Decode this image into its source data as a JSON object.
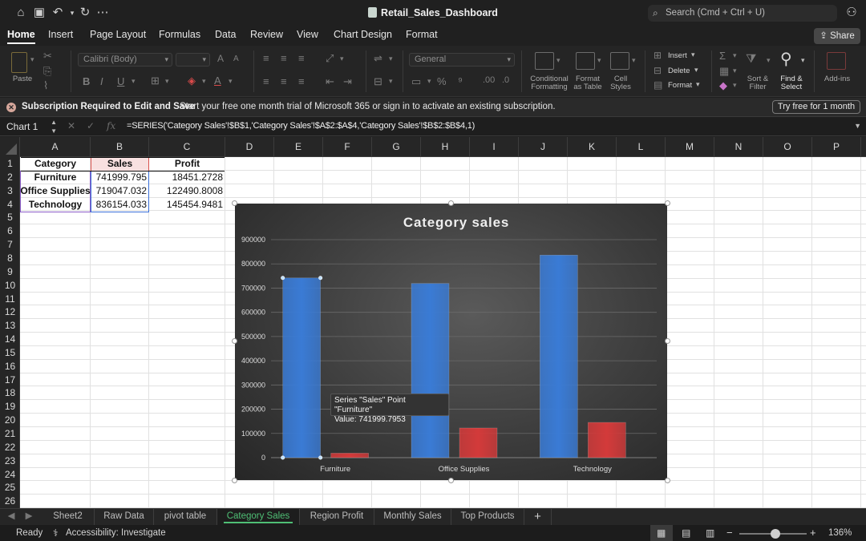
{
  "titlebar": {
    "doc_title": "Retail_Sales_Dashboard",
    "search_placeholder": "Search (Cmd + Ctrl + U)"
  },
  "ribbon_tabs": [
    "Home",
    "Insert",
    "Page Layout",
    "Formulas",
    "Data",
    "Review",
    "View",
    "Chart Design",
    "Format"
  ],
  "share_label": "Share",
  "ribbon": {
    "paste": "Paste",
    "font_name": "Calibri (Body)",
    "number_format": "General",
    "conditional_formatting": [
      "Conditional",
      "Formatting"
    ],
    "format_as_table": [
      "Format",
      "as Table"
    ],
    "cell_styles": [
      "Cell",
      "Styles"
    ],
    "insert": "Insert",
    "delete": "Delete",
    "format": "Format",
    "sort_filter": [
      "Sort &",
      "Filter"
    ],
    "find_select": [
      "Find &",
      "Select"
    ],
    "addins": "Add-ins",
    "bold": "B",
    "italic": "I",
    "underline": "U",
    "font_color": "A",
    "grow": "A",
    "shrink": "A"
  },
  "notice": {
    "title": "Subscription Required to Edit and Save",
    "message": "Start your free one month trial of Microsoft 365 or sign in to activate an existing subscription.",
    "button": "Try free for 1 month"
  },
  "formula_bar": {
    "name_box": "Chart 1",
    "fx": "fx",
    "formula": "=SERIES('Category Sales'!$B$1,'Category Sales'!$A$2:$A$4,'Category Sales'!$B$2:$B$4,1)"
  },
  "columns": [
    "A",
    "B",
    "C",
    "D",
    "E",
    "F",
    "G",
    "H",
    "I",
    "J",
    "K",
    "L",
    "M",
    "N",
    "O",
    "P"
  ],
  "rows": [
    "1",
    "2",
    "3",
    "4",
    "5",
    "6",
    "7",
    "8",
    "9",
    "10",
    "11",
    "12",
    "13",
    "14",
    "15",
    "16",
    "17",
    "18",
    "19",
    "20",
    "21",
    "22",
    "23",
    "24",
    "25",
    "26"
  ],
  "table": {
    "headers": [
      "Category",
      "Sales",
      "Profit"
    ],
    "rows": [
      [
        "Furniture",
        "741999.795",
        "18451.2728"
      ],
      [
        "Office Supplies",
        "719047.032",
        "122490.8008"
      ],
      [
        "Technology",
        "836154.033",
        "145454.9481"
      ]
    ]
  },
  "chart_data": {
    "type": "bar",
    "title": "Category sales",
    "categories": [
      "Furniture",
      "Office Supplies",
      "Technology"
    ],
    "series": [
      {
        "name": "Sales",
        "values": [
          741999.7953,
          719047.032,
          836154.033
        ],
        "color": "#3a7bd5"
      },
      {
        "name": "Profit",
        "values": [
          18451.2728,
          122490.8008,
          145454.9481
        ],
        "color": "#d33a3a"
      }
    ],
    "yticks": [
      "0",
      "100000",
      "200000",
      "300000",
      "400000",
      "500000",
      "600000",
      "700000",
      "800000",
      "900000"
    ],
    "ylim": [
      0,
      900000
    ],
    "grid": true,
    "legend": "none"
  },
  "tooltip": {
    "line1": "Series \"Sales\" Point \"Furniture\"",
    "line2": "Value: 741999.7953"
  },
  "sheet_tabs": [
    "Sheet2",
    "Raw Data",
    "pivot table",
    "Category Sales",
    "Region Profit",
    "Monthly Sales",
    "Top Products"
  ],
  "active_sheet": "Category Sales",
  "status": {
    "ready": "Ready",
    "accessibility": "Accessibility: Investigate",
    "zoom": "136%"
  },
  "colors": {
    "accent_green": "#4fbf75",
    "sales_bar": "#3a7bd5",
    "profit_bar": "#d33a3a"
  }
}
